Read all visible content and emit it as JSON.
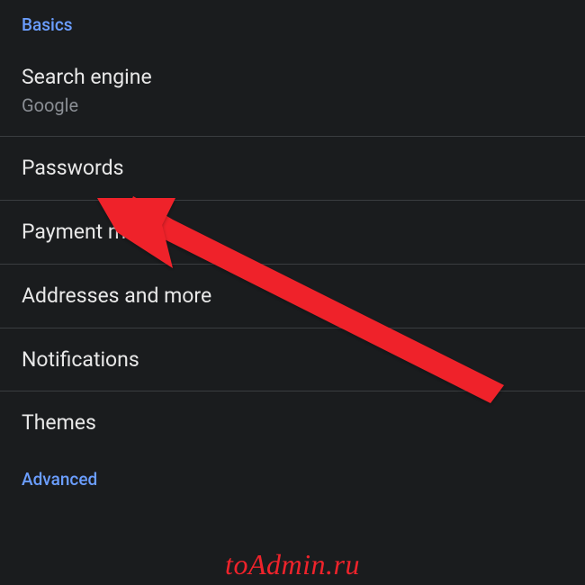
{
  "sections": {
    "basics": {
      "header": "Basics",
      "items": [
        {
          "title": "Search engine",
          "subtitle": "Google"
        },
        {
          "title": "Passwords"
        },
        {
          "title": "Payment methods"
        },
        {
          "title": "Addresses and more"
        },
        {
          "title": "Notifications"
        },
        {
          "title": "Themes"
        }
      ]
    },
    "advanced": {
      "header": "Advanced"
    }
  },
  "watermark": "toAdmin.ru"
}
